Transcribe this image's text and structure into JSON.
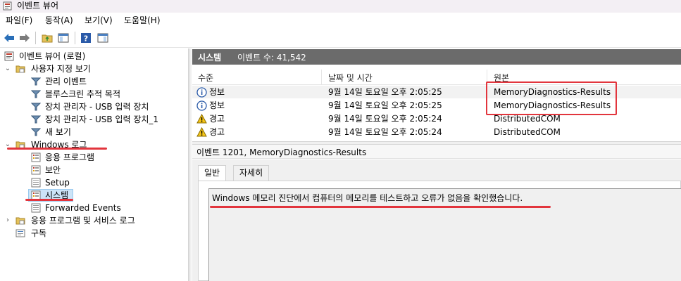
{
  "window": {
    "title": "이벤트 뷰어"
  },
  "menu": [
    "파일(F)",
    "동작(A)",
    "보기(V)",
    "도움말(H)"
  ],
  "toolbar": {
    "icons": [
      "back-arrow-icon",
      "forward-arrow-icon",
      "folder-up-icon",
      "show-hide-tree-icon",
      "help-icon",
      "show-hide-action-pane-icon"
    ]
  },
  "tree": {
    "root": "이벤트 뷰어 (로컬)",
    "custom_views": "사용자 지정 보기",
    "admin_events": "관리 이벤트",
    "bluescreen": "블루스크린 추적 목적",
    "device_usb": "장치 관리자 - USB 입력 장치",
    "device_usb_1": "장치 관리자 - USB 입력 장치_1",
    "new_view": "새 보기",
    "windows_logs": "Windows 로그",
    "application": "응용 프로그램",
    "security": "보안",
    "setup": "Setup",
    "system": "시스템",
    "forwarded": "Forwarded Events",
    "apps_services": "응용 프로그램 및 서비스 로그",
    "subscriptions": "구독"
  },
  "log_header": {
    "name": "시스템",
    "count": "이벤트 수: 41,542"
  },
  "columns": {
    "level": "수준",
    "datetime": "날짜 및 시간",
    "source": "원본"
  },
  "events": [
    {
      "level": "정보",
      "level_icon": "info-icon",
      "datetime": "9월 14일 토요일 오후 2:05:25",
      "source": "MemoryDiagnostics-Results"
    },
    {
      "level": "정보",
      "level_icon": "info-icon",
      "datetime": "9월 14일 토요일 오후 2:05:25",
      "source": "MemoryDiagnostics-Results"
    },
    {
      "level": "경고",
      "level_icon": "warning-icon",
      "datetime": "9월 14일 토요일 오후 2:05:24",
      "source": "DistributedCOM"
    },
    {
      "level": "경고",
      "level_icon": "warning-icon",
      "datetime": "9월 14일 토요일 오후 2:05:24",
      "source": "DistributedCOM"
    }
  ],
  "detail": {
    "header": "이벤트 1201, MemoryDiagnostics-Results",
    "tabs": [
      "일반",
      "자세히"
    ],
    "message": "Windows 메모리 진단에서 컴퓨터의 메모리를 테스트하고 오류가 없음을 확인했습니다."
  },
  "colors": {
    "annotation": "#e2353d",
    "header_bar": "#6b6b6b"
  }
}
